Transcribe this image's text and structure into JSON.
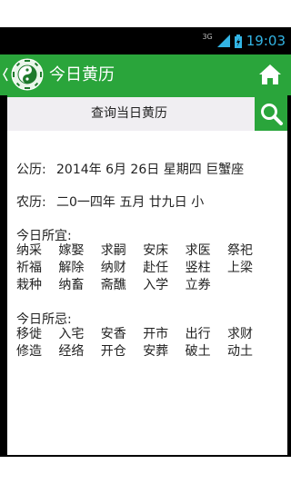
{
  "status_bar": {
    "network_type": "3G",
    "time": "19:03",
    "accent_color": "#33b5e5",
    "icons": [
      "signal-icon",
      "battery-charging-icon"
    ]
  },
  "app_bar": {
    "title": "今日黄历",
    "background_color": "#2aa53b",
    "icons": [
      "back-chevron-icon",
      "taiji-logo-icon",
      "home-icon"
    ]
  },
  "search_bar": {
    "label": "查询当日黄历",
    "icon": "search-icon"
  },
  "calendar": {
    "solar_label": "公历:",
    "solar_value": "2014年 6月 26日 星期四 巨蟹座",
    "lunar_label": "农历:",
    "lunar_value": "二0一四年 五月 廿九日 小"
  },
  "yi": {
    "title": "今日所宜:",
    "items": [
      "纳采",
      "嫁娶",
      "求嗣",
      "安床",
      "求医",
      "祭祀",
      "祈福",
      "解除",
      "纳财",
      "赴任",
      "竖柱",
      "上梁",
      "栽种",
      "纳畜",
      "斋醮",
      "入学",
      "立券"
    ]
  },
  "ji": {
    "title": "今日所忌:",
    "items": [
      "移徙",
      "入宅",
      "安香",
      "开市",
      "出行",
      "求财",
      "修造",
      "经络",
      "开仓",
      "安葬",
      "破土",
      "动土"
    ]
  }
}
